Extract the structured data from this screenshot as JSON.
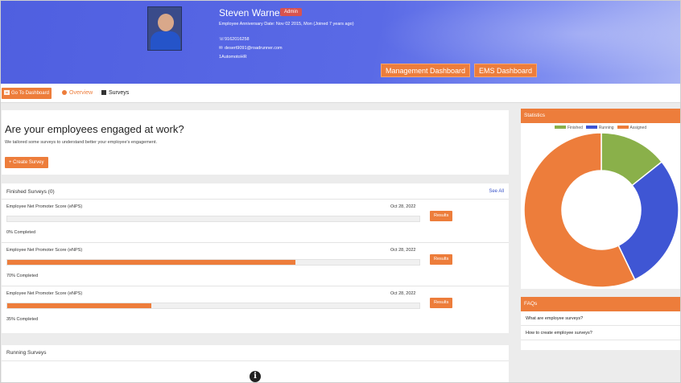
{
  "profile": {
    "name": "Steven Warner",
    "badge": "Admin",
    "anniversary": "Employee Anniversary Date: Nov 02 2015, Mon (Joined 7 years ago)",
    "phone": "9162016258",
    "email": "desert9091@roadrunner.com",
    "company": "1AutomotoHR",
    "buttons": [
      "Management Dashboard",
      "EMS Dashboard"
    ]
  },
  "toolbar": {
    "goto_label": "Go To Dashboard",
    "overview_label": "Overview",
    "surveys_label": "Surveys"
  },
  "engaged": {
    "heading": "Are your employees engaged at work?",
    "subtext": "We tailored some surveys to understand better your employee's engagement.",
    "create_label": "Create Survey"
  },
  "finished": {
    "title": "Finished Surveys (0)",
    "see_all": "See All",
    "surveys": [
      {
        "name": "Employee Net Promoter Score (eNPS)",
        "date": "Oct 28, 2022",
        "percent": 0,
        "completed_text": "0% Completed",
        "results_label": "Results"
      },
      {
        "name": "Employee Net Promoter Score (eNPS)",
        "date": "Oct 28, 2022",
        "percent": 70,
        "completed_text": "70% Completed",
        "results_label": "Results"
      },
      {
        "name": "Employee Net Promoter Score (eNPS)",
        "date": "Oct 28, 2022",
        "percent": 35,
        "completed_text": "35% Completed",
        "results_label": "Results"
      }
    ]
  },
  "running": {
    "title": "Running Surveys"
  },
  "statistics": {
    "title": "Statistics"
  },
  "chart_data": {
    "type": "pie",
    "donut": true,
    "legend_position": "top",
    "series": [
      {
        "name": "Finished",
        "value": 1,
        "color": "#8ab04a"
      },
      {
        "name": "Running",
        "value": 2,
        "color": "#3f56d4"
      },
      {
        "name": "Assigned",
        "value": 4,
        "color": "#ed7d3b"
      }
    ]
  },
  "faqs": {
    "title": "FAQs",
    "items": [
      "What are employee surveys?",
      "How to create employee surveys?"
    ]
  },
  "colors": {
    "accent": "#ed7d3b",
    "header": "#5566e3",
    "link": "#3b55c9"
  }
}
